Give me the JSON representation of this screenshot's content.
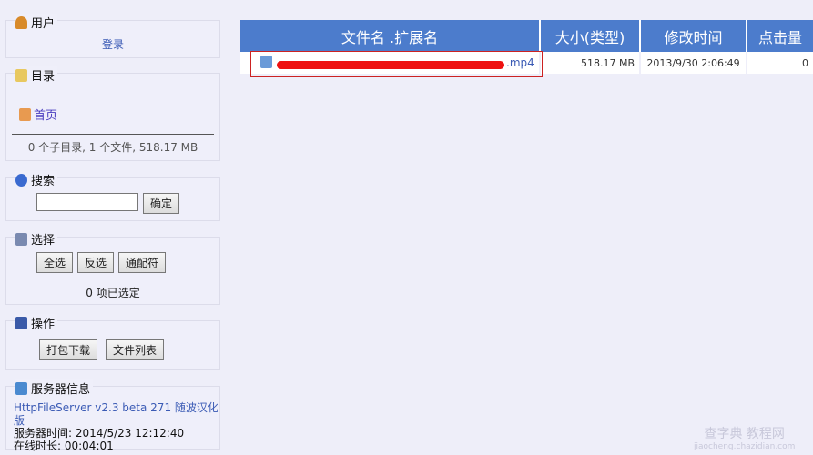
{
  "user": {
    "title": "用户",
    "login": "登录"
  },
  "folder": {
    "title": "目录",
    "home": "首页",
    "summary": "0 个子目录, 1 个文件, 518.17 MB"
  },
  "search": {
    "title": "搜索",
    "value": "",
    "ok": "确定"
  },
  "select": {
    "title": "选择",
    "all": "全选",
    "invert": "反选",
    "wildcard": "通配符",
    "status": "0 项已选定"
  },
  "actions": {
    "title": "操作",
    "archive": "打包下载",
    "filelist": "文件列表"
  },
  "server": {
    "title": "服务器信息",
    "version": "HttpFileServer v2.3 beta 271 随波汉化版",
    "time": "服务器时间: 2014/5/23 12:12:40",
    "uptime": "在线时长: 00:04:01"
  },
  "table": {
    "headers": [
      "文件名 .扩展名",
      "大小(类型)",
      "修改时间",
      "点击量"
    ],
    "rows": [
      {
        "name": ".mp4",
        "size": "518.17 MB",
        "modified": "2013/9/30 2:06:49",
        "hits": "0"
      }
    ]
  },
  "colors": {
    "header": "#4c7ccc",
    "highlight": "#cc2222",
    "redaction": "#ee1111"
  },
  "watermark": {
    "line1": "查字典 教程网",
    "line2": "jiaocheng.chazidian.com"
  }
}
